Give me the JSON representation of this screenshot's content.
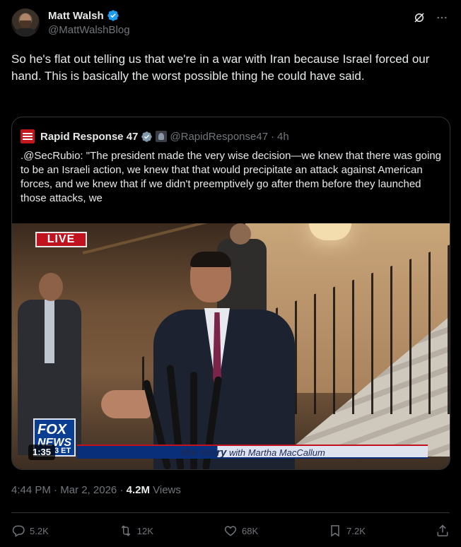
{
  "author": {
    "name": "Matt Walsh",
    "handle": "@MattWalshBlog"
  },
  "tweet": {
    "text": "So he's flat out telling us that we're in a war with Iran because Israel forced our hand. This is basically the worst possible thing he could have said."
  },
  "quoted": {
    "name": "Rapid Response 47",
    "handle": "@RapidResponse47",
    "separator": "·",
    "time": "4h",
    "text": ".@SecRubio: \"The president made the very wise decision—we knew that there was going to be an Israeli action, we knew that that would precipitate an attack against American forces, and we knew that if we didn't preemptively go after them before they launched those attacks, we",
    "video": {
      "live_label": "LIVE",
      "network_line1": "FOX",
      "network_line2": "NEWS",
      "timezone": "3 ET",
      "show_title": "the story",
      "show_host": "with Martha MacCallum",
      "duration": "1:35"
    }
  },
  "meta": {
    "time": "4:44 PM",
    "separator": "·",
    "date": "Mar 2, 2026",
    "views_count": "4.2M",
    "views_label": "Views"
  },
  "actions": {
    "replies": "5.2K",
    "reposts": "12K",
    "likes": "68K",
    "bookmarks": "7.2K"
  },
  "colors": {
    "background": "#000000",
    "text": "#e7e9ea",
    "muted": "#71767b",
    "border": "#2f3336",
    "verified": "#1d9bf0"
  }
}
